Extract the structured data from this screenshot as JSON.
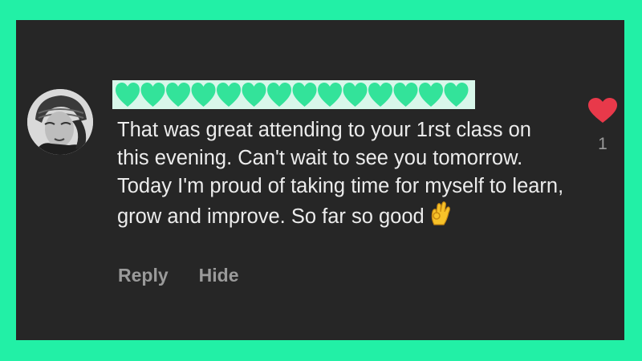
{
  "comment": {
    "text": "That was great attending to your 1rst class on this evening. Can't wait to see you tomorrow. Today I'm proud of taking time for myself to learn, grow and improve. So far so good",
    "emoji": "ok-hand-icon"
  },
  "actions": {
    "reply_label": "Reply",
    "hide_label": "Hide"
  },
  "like": {
    "count": "1",
    "icon": "heart-icon",
    "color": "#e8394a"
  },
  "colors": {
    "border": "#22f0a6",
    "background": "#262626",
    "text": "#ececec",
    "muted": "#9a9a9a",
    "redaction": "#d8f7ea",
    "redaction_hearts": "#33e39a"
  }
}
